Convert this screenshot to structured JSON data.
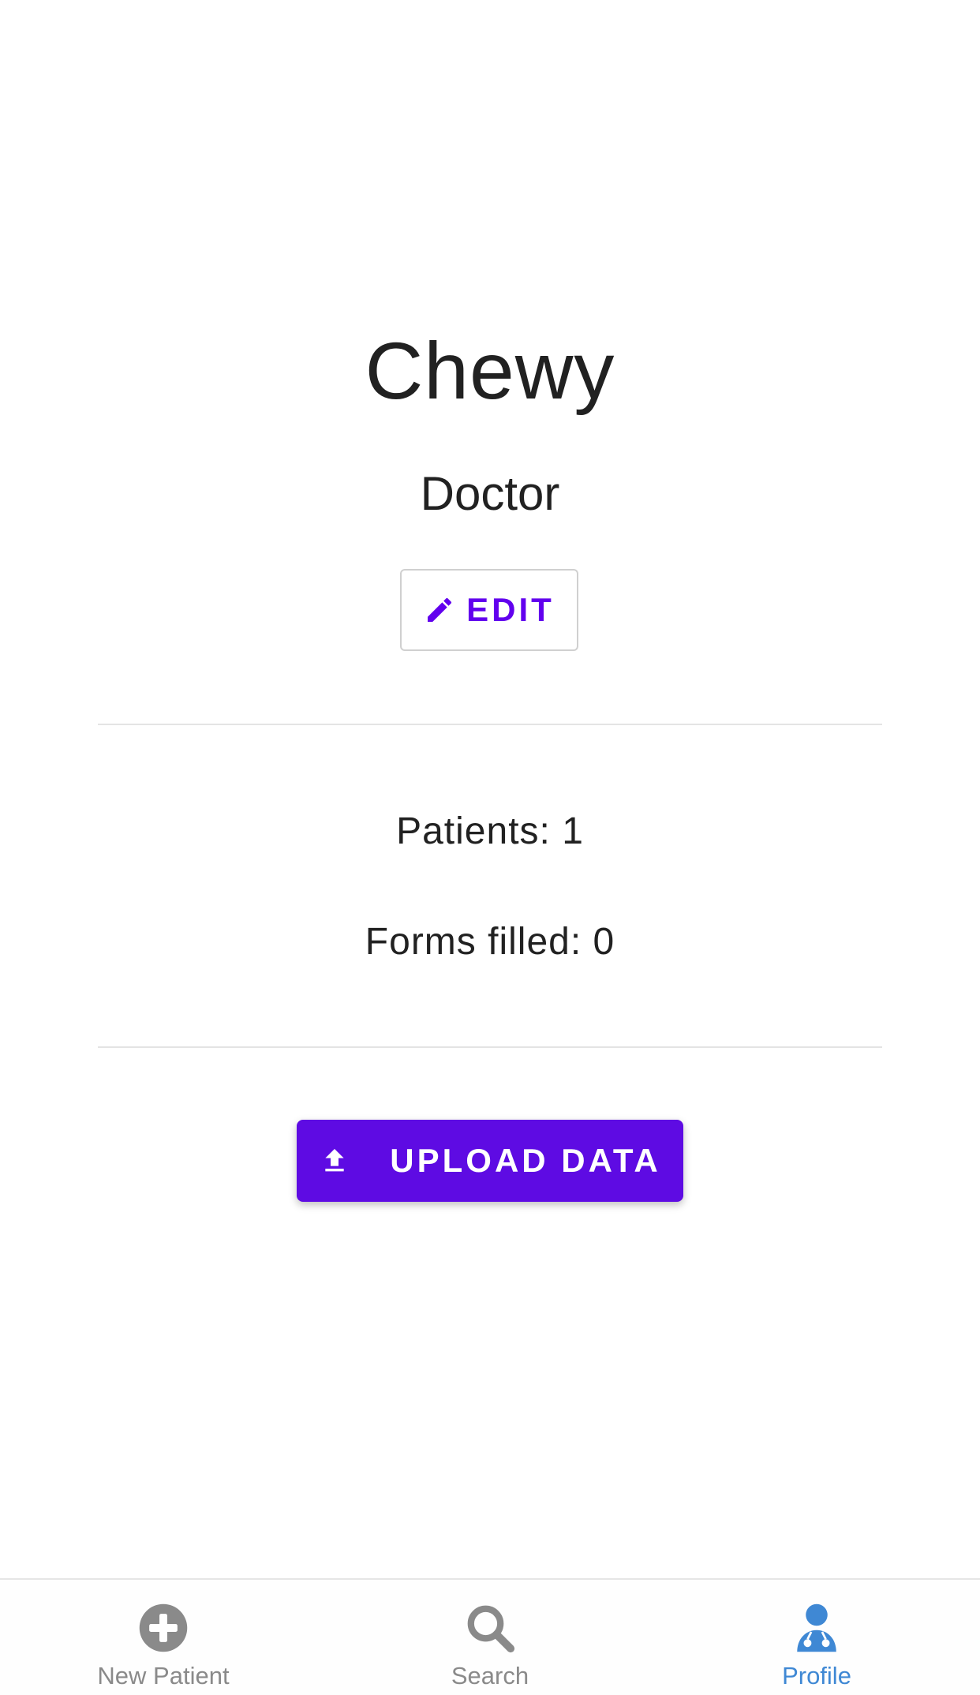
{
  "profile": {
    "name": "Chewy",
    "role": "Doctor"
  },
  "actions": {
    "edit_label": "EDIT",
    "upload_label": "UPLOAD DATA"
  },
  "stats": {
    "patients": "Patients: 1",
    "forms_filled": "Forms filled: 0"
  },
  "tabbar": {
    "items": [
      {
        "label": "New Patient",
        "icon": "plus-circle-icon",
        "active": false
      },
      {
        "label": "Search",
        "icon": "search-icon",
        "active": false
      },
      {
        "label": "Profile",
        "icon": "doctor-icon",
        "active": true
      }
    ]
  },
  "colors": {
    "accent": "#6200ee",
    "upload_button": "#5e0be3",
    "tab_active": "#3f88d4",
    "tab_inactive": "#8a8a8a"
  }
}
